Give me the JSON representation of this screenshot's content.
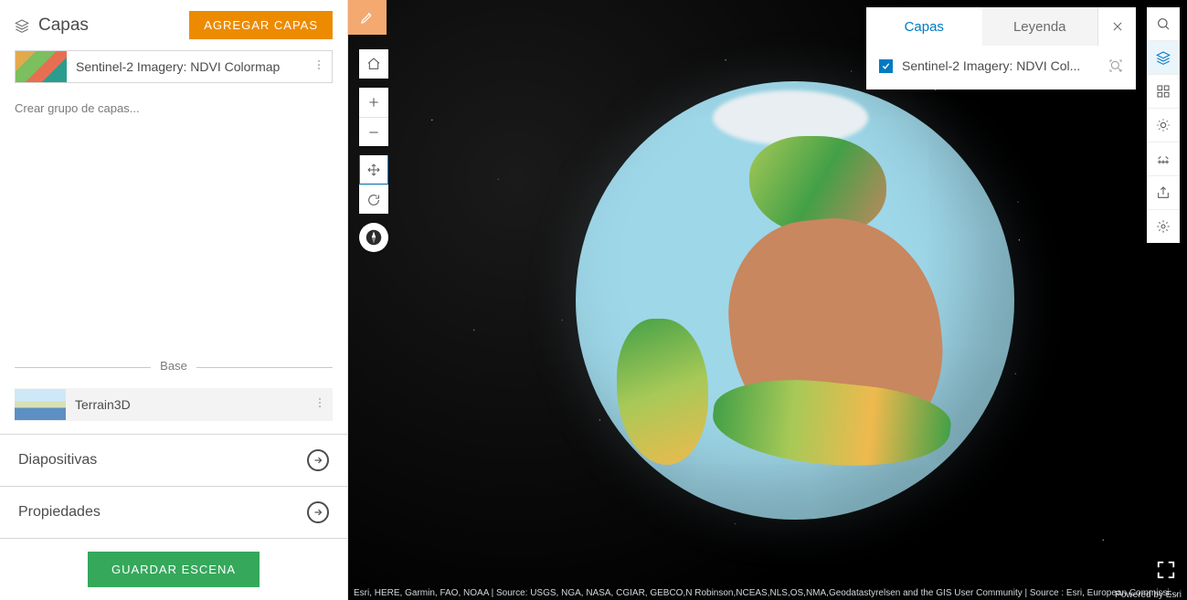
{
  "sidebar": {
    "title": "Capas",
    "add_layers_label": "AGREGAR CAPAS",
    "layer": {
      "name": "Sentinel-2 Imagery: NDVI Colormap"
    },
    "create_group_label": "Crear grupo de capas...",
    "base_divider_label": "Base",
    "basemap": {
      "name": "Terrain3D"
    },
    "accordion": {
      "slides_label": "Diapositivas",
      "properties_label": "Propiedades"
    },
    "save_label": "GUARDAR ESCENA"
  },
  "float_panel": {
    "tab_layers_label": "Capas",
    "tab_legend_label": "Leyenda",
    "layer_label": "Sentinel-2 Imagery: NDVI Col..."
  },
  "scene": {
    "attribution": "Esri, HERE, Garmin, FAO, NOAA | Source: USGS, NGA, NASA, CGIAR, GEBCO,N Robinson,NCEAS,NLS,OS,NMA,Geodatastyrelsen and the GIS User Community | Source : Esri, European Commission, E...",
    "powered_by": "Powered by Esri"
  }
}
